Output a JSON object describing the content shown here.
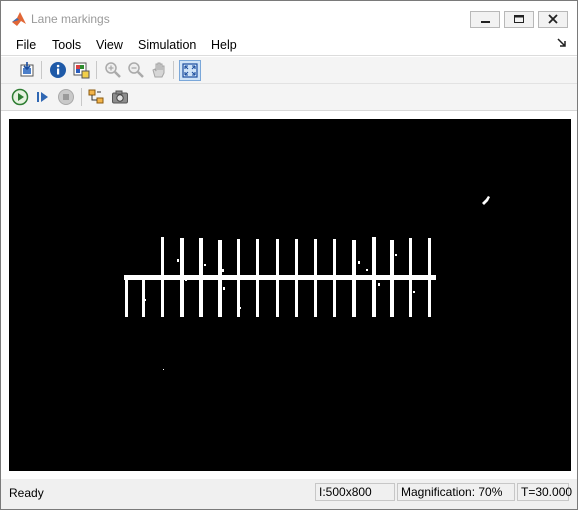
{
  "window": {
    "title": "Lane markings"
  },
  "menu": [
    "File",
    "Tools",
    "View",
    "Simulation",
    "Help"
  ],
  "toolbar1": [
    {
      "name": "export-to-workspace-icon"
    },
    {
      "name": "image-information-icon"
    },
    {
      "name": "pixel-region-icon"
    },
    {
      "name": "zoom-in-icon"
    },
    {
      "name": "zoom-out-icon"
    },
    {
      "name": "pan-icon"
    },
    {
      "name": "fit-to-view-icon"
    }
  ],
  "toolbar2": [
    {
      "name": "run-icon"
    },
    {
      "name": "step-forward-icon"
    },
    {
      "name": "stop-icon"
    },
    {
      "name": "highlight-simulink-signal-icon"
    },
    {
      "name": "snapshot-icon"
    }
  ],
  "status": {
    "ready": "Ready",
    "size": "I:500x800",
    "magnification": "Magnification: 70%",
    "time": "T=30.000"
  },
  "colors": {
    "viewer_bg": "#000000",
    "marking": "#ffffff",
    "title_disabled": "#9a9a9a"
  }
}
